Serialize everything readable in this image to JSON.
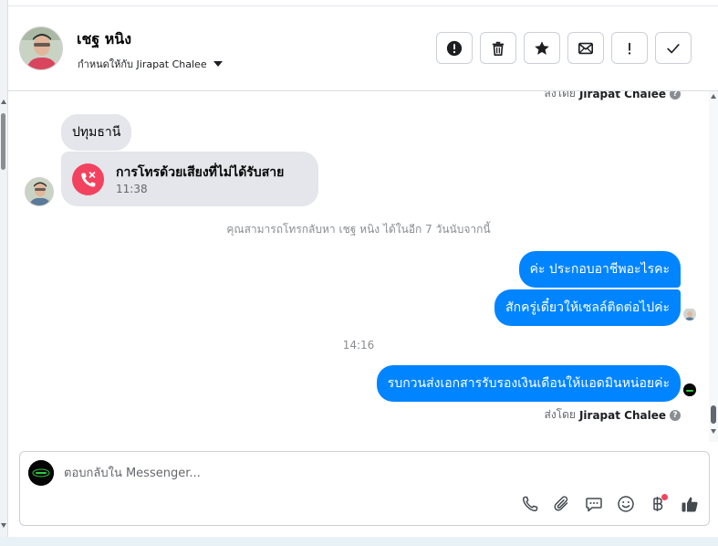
{
  "header": {
    "contact_name": "เชฐ หนิง",
    "assigned_to": "กำหนดให้กับ Jirapat Chalee",
    "actions": [
      {
        "name": "report-button",
        "icon": "alert-circle-icon"
      },
      {
        "name": "delete-button",
        "icon": "trash-icon"
      },
      {
        "name": "star-button",
        "icon": "star-icon"
      },
      {
        "name": "mark-unread-button",
        "icon": "envelope-icon"
      },
      {
        "name": "follow-up-button",
        "icon": "exclamation-icon"
      },
      {
        "name": "mark-done-button",
        "icon": "checkmark-icon"
      }
    ]
  },
  "chat": {
    "sent_by_prefix": "ส่งโดย",
    "sent_by_name": "Jirapat Chalee",
    "incoming_message": "ปทุมธานี",
    "missed_call": {
      "title": "การโทรด้วยเสียงที่ไม่ได้รับสาย",
      "time": "11:38"
    },
    "callback_note": "คุณสามารถโทรกลับหา เชฐ หนิง ได้ในอีก 7 วันนับจากนี้",
    "time_separator": "14:16",
    "outgoing": [
      "ค่ะ ประกอบอาชีพอะไรคะ",
      "สักครู่เดี๋ยวให้เซลล์ติดต่อไปค่ะ",
      "รบกวนส่งเอกสารรับรองเงินเดือนให้แอดมินหน่อยค่ะ"
    ]
  },
  "composer": {
    "placeholder": "ตอบกลับใน Messenger...",
    "tools": [
      "phone-icon",
      "paperclip-icon",
      "saved-replies-icon",
      "emoji-icon",
      "baht-payment-icon",
      "thumbs-up-icon"
    ]
  },
  "colors": {
    "brand_blue": "#0084ff",
    "missed_call_red": "#f3425f",
    "bubble_gray": "#e4e6eb"
  }
}
